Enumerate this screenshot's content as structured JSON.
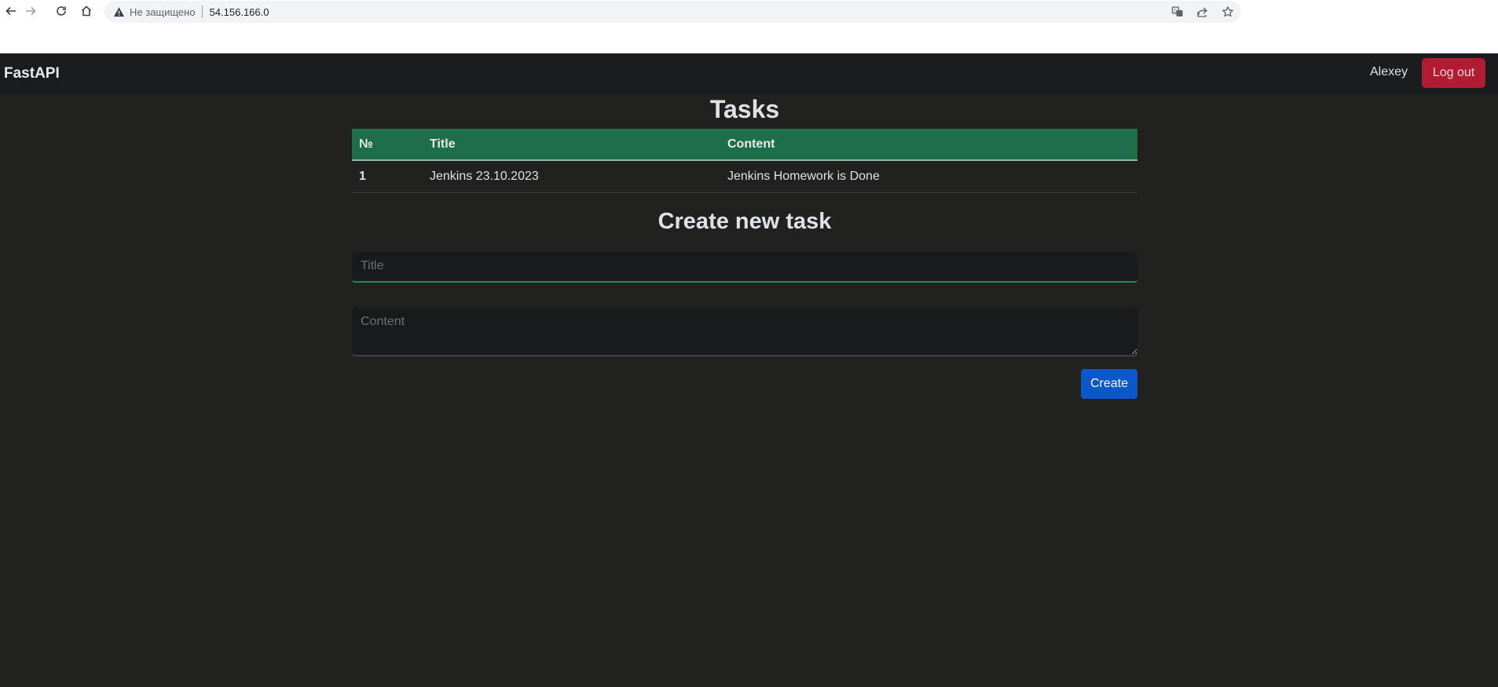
{
  "browser": {
    "security_label": "Не защищено",
    "url": "54.156.166.0"
  },
  "navbar": {
    "brand": "FastAPI",
    "username": "Alexey",
    "logout_label": "Log out"
  },
  "tasks": {
    "heading": "Tasks",
    "columns": [
      "№",
      "Title",
      "Content"
    ],
    "rows": [
      {
        "num": "1",
        "title": "Jenkins 23.10.2023",
        "content": "Jenkins Homework is Done"
      }
    ]
  },
  "create_form": {
    "heading": "Create new task",
    "title_placeholder": "Title",
    "content_placeholder": "Content",
    "submit_label": "Create"
  },
  "colors": {
    "page_bg": "#212220",
    "navbar_bg": "#1a1c1e",
    "table_header_bg": "#1d6e49",
    "logout_bg": "#b11c33",
    "create_bg": "#0a58ca"
  }
}
